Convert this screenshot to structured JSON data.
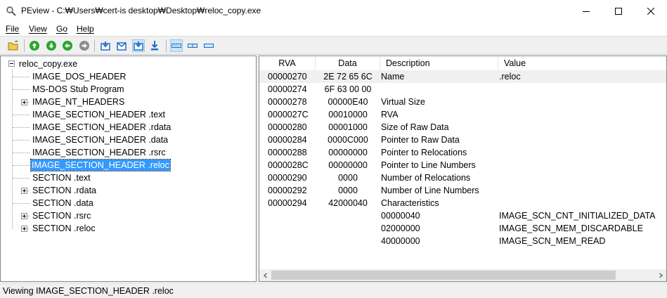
{
  "window": {
    "title": "PEview - C:₩Users₩cert-is desktop₩Desktop₩reloc_copy.exe",
    "icon": "magnifier-icon"
  },
  "menu": {
    "items": [
      {
        "underline": "F",
        "rest": "ile"
      },
      {
        "underline": "V",
        "rest": "iew"
      },
      {
        "underline": "G",
        "rest": "o"
      },
      {
        "underline": "H",
        "rest": "elp"
      }
    ]
  },
  "toolbar": {
    "icons": [
      "open-folder-icon",
      "go-up-icon",
      "go-down-icon",
      "go-back-icon",
      "go-forward-icon",
      "view-byte-icon",
      "view-word-icon",
      "view-dword-icon",
      "view-qword-icon",
      "view-details-icon",
      "view-hex-icon",
      "view-text-icon"
    ],
    "colors": {
      "green": "#2aa52a",
      "blue": "#1f6fc5",
      "gray": "#8c8c8c"
    }
  },
  "tree": {
    "root": "reloc_copy.exe",
    "nodes": [
      {
        "label": "IMAGE_DOS_HEADER",
        "expander": "none"
      },
      {
        "label": "MS-DOS Stub Program",
        "expander": "none"
      },
      {
        "label": "IMAGE_NT_HEADERS",
        "expander": "plus"
      },
      {
        "label": "IMAGE_SECTION_HEADER .text",
        "expander": "none"
      },
      {
        "label": "IMAGE_SECTION_HEADER .rdata",
        "expander": "none"
      },
      {
        "label": "IMAGE_SECTION_HEADER .data",
        "expander": "none"
      },
      {
        "label": "IMAGE_SECTION_HEADER .rsrc",
        "expander": "none"
      },
      {
        "label": "IMAGE_SECTION_HEADER .reloc",
        "expander": "none",
        "selected": true
      },
      {
        "label": "SECTION .text",
        "expander": "none"
      },
      {
        "label": "SECTION .rdata",
        "expander": "plus"
      },
      {
        "label": "SECTION .data",
        "expander": "none"
      },
      {
        "label": "SECTION .rsrc",
        "expander": "plus"
      },
      {
        "label": "SECTION .reloc",
        "expander": "plus"
      }
    ]
  },
  "list": {
    "columns": [
      "RVA",
      "Data",
      "Description",
      "Value"
    ],
    "rows": [
      {
        "rva": "00000270",
        "data": "2E  72  65  6C",
        "desc": "Name",
        "value": ".reloc"
      },
      {
        "rva": "00000274",
        "data": "6F  63  00  00",
        "desc": "",
        "value": ""
      },
      {
        "rva": "00000278",
        "data": "00000E40",
        "desc": "Virtual Size",
        "value": ""
      },
      {
        "rva": "0000027C",
        "data": "00010000",
        "desc": "RVA",
        "value": ""
      },
      {
        "rva": "00000280",
        "data": "00001000",
        "desc": "Size of Raw Data",
        "value": ""
      },
      {
        "rva": "00000284",
        "data": "0000C000",
        "desc": "Pointer to Raw Data",
        "value": ""
      },
      {
        "rva": "00000288",
        "data": "00000000",
        "desc": "Pointer to Relocations",
        "value": ""
      },
      {
        "rva": "0000028C",
        "data": "00000000",
        "desc": "Pointer to Line Numbers",
        "value": ""
      },
      {
        "rva": "00000290",
        "data": "0000",
        "desc": "Number of Relocations",
        "value": ""
      },
      {
        "rva": "00000292",
        "data": "0000",
        "desc": "Number of Line Numbers",
        "value": ""
      },
      {
        "rva": "00000294",
        "data": "42000040",
        "desc": "Characteristics",
        "value": ""
      },
      {
        "rva": "",
        "data": "",
        "desc": "00000040",
        "value": "IMAGE_SCN_CNT_INITIALIZED_DATA"
      },
      {
        "rva": "",
        "data": "",
        "desc": "02000000",
        "value": "IMAGE_SCN_MEM_DISCARDABLE"
      },
      {
        "rva": "",
        "data": "",
        "desc": "40000000",
        "value": "IMAGE_SCN_MEM_READ"
      }
    ]
  },
  "status": {
    "text": "Viewing IMAGE_SECTION_HEADER .reloc"
  },
  "colors": {
    "selection": "#3399ff",
    "row_highlight": "#f0f0f0"
  }
}
